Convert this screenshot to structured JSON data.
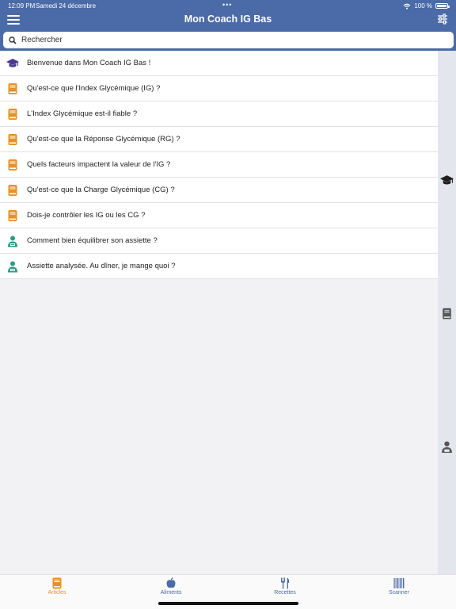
{
  "status": {
    "time": "12:09 PM",
    "date": "Samedi 24 décembre",
    "dots": "•••",
    "battery": "100 %"
  },
  "nav": {
    "title": "Mon Coach IG Bas"
  },
  "search": {
    "placeholder": "Rechercher"
  },
  "colors": {
    "header": "#4a6aa8",
    "graduation": "#4b3a8f",
    "book": "#e8902a",
    "coach": "#2e9b8a",
    "tab_active": "#e8902a",
    "tab_inactive": "#4a6aa8"
  },
  "articles": [
    {
      "icon": "graduation-cap-icon",
      "label": "Bienvenue dans Mon Coach IG Bas !"
    },
    {
      "icon": "book-icon",
      "label": "Qu'est-ce que l'Index Glycémique (IG) ?"
    },
    {
      "icon": "book-icon",
      "label": "L'Index Glycémique est-il fiable ?"
    },
    {
      "icon": "book-icon",
      "label": "Qu'est-ce que la Réponse Glycémique (RG) ?"
    },
    {
      "icon": "book-icon",
      "label": "Quels facteurs impactent la valeur de l'IG ?"
    },
    {
      "icon": "book-icon",
      "label": "Qu'est-ce que la Charge Glycémique (CG) ?"
    },
    {
      "icon": "book-icon",
      "label": "Dois-je contrôler les IG ou les CG ?"
    },
    {
      "icon": "coach-icon",
      "label": "Comment bien équilibrer son assiette ?"
    },
    {
      "icon": "coach-icon",
      "label": "Assiette analysée. Au dîner, je mange quoi ?"
    }
  ],
  "index_icons": [
    "graduation-cap-icon",
    "book-icon",
    "coach-icon"
  ],
  "tabs": [
    {
      "label": "Articles",
      "icon": "book-icon",
      "active": true
    },
    {
      "label": "Aliments",
      "icon": "apple-icon",
      "active": false
    },
    {
      "label": "Recettes",
      "icon": "utensils-icon",
      "active": false
    },
    {
      "label": "Scanner",
      "icon": "barcode-icon",
      "active": false
    }
  ]
}
